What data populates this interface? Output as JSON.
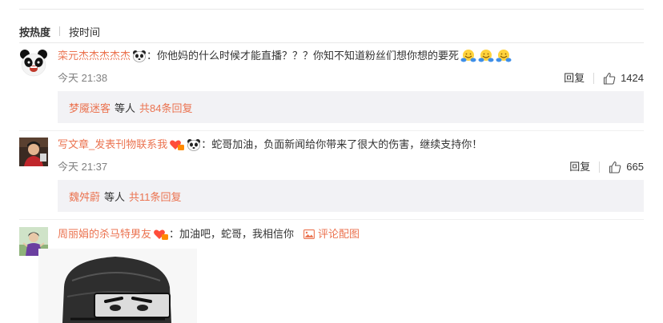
{
  "sort": {
    "hot_label": "按热度",
    "time_label": "按时间"
  },
  "comments": [
    {
      "username": "栾元杰杰杰杰杰",
      "colon": "：",
      "text": "你他妈的什么时候才能直播？？？你知不知道粉丝们想你想的要死",
      "time": "今天 21:38",
      "reply_label": "回复",
      "likes": "1424",
      "sub": {
        "name": "梦魇迷客",
        "text": "等人",
        "count": "共84条回复"
      }
    },
    {
      "username": "写文章_发表刊物联系我",
      "colon": "：",
      "text": "蛇哥加油，负面新闻给你带来了很大的伤害，继续支持你！",
      "time": "今天 21:37",
      "reply_label": "回复",
      "likes": "665",
      "sub": {
        "name": "魏舛蔚",
        "text": "等人",
        "count": "共11条回复"
      }
    },
    {
      "username": "周丽娟的杀马特男友",
      "colon": "：",
      "text": "加油吧，蛇哥，我相信你",
      "pic_label": "评论配图"
    }
  ],
  "icons": {
    "panda": "panda-emoji-icon",
    "hug": "hug-emoji-icon",
    "vip": "vip-heart-badge-icon",
    "like": "thumbs-up-icon",
    "picture": "picture-icon"
  },
  "colors": {
    "accent": "#eb7350",
    "subbg": "#f2f2f5",
    "text": "#333333",
    "meta": "#808080"
  }
}
